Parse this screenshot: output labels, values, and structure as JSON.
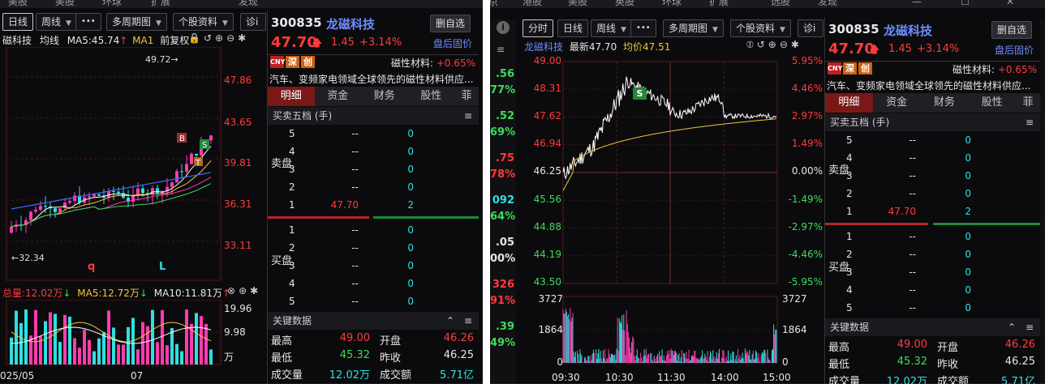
{
  "top_menu_left": [
    "美股",
    "美股",
    "环球",
    "扩展",
    "发现"
  ],
  "top_menu_right": [
    "港股",
    "美股",
    "英股",
    "环球",
    "扩展",
    "选股",
    "发现"
  ],
  "stock": {
    "code": "300835",
    "name": "龙磁科技",
    "price": "47.70",
    "change": "1.45",
    "change_pct": "+3.14%",
    "watch_button": "删自选",
    "after_hours": "盘后固价",
    "tag_cny": "CNY",
    "tag_shen": "深",
    "tag_chuang": "创",
    "sector_label": "磁性材料:",
    "sector_pct": "+0.65%",
    "description": "汽车、变频家电领域全球领先的磁性材料供应..."
  },
  "left_toolbar": {
    "period": "日线",
    "week": "周线",
    "more": "•••",
    "multi": "多周期图",
    "profile": "个股资料",
    "diag": "诊ⅰ"
  },
  "right_toolbar": {
    "period": "分时",
    "day": "日线",
    "week": "周线",
    "more": "•••",
    "multi": "多周期图",
    "profile": "个股资料",
    "diag": "诊ⅰ"
  },
  "kline": {
    "name": "磁科技",
    "ma_label": "均线",
    "ma5": "MA5:45.74",
    "ma1": "MA1",
    "adjust": "前复权",
    "price_axis": [
      "47.86",
      "43.65",
      "39.81",
      "36.31",
      "33.11"
    ],
    "high_note": "49.72",
    "low_note": "32.34",
    "marker_q": "q",
    "marker_l": "L",
    "marker_b": "B",
    "marker_s": "S",
    "marker_t": "T",
    "vol_total": "总量:12.02万",
    "vol_ma5": "MA5:12.72万",
    "vol_ma10": "MA10:11.81万",
    "vol_axis": [
      "19.96",
      "9.98",
      "万"
    ],
    "date_axis": [
      "025/05",
      "07"
    ]
  },
  "intraday": {
    "name": "龙磁科技",
    "latest_label": "最新47.70",
    "avg_label": "均价47.51",
    "price_axis": [
      "49.00",
      "48.31",
      "47.62",
      "46.94",
      "46.25",
      "45.56",
      "44.88",
      "44.19",
      "43.50"
    ],
    "pct_axis": [
      "5.95%",
      "4.46%",
      "2.97%",
      "1.49%",
      "0.00%",
      "-1.49%",
      "-2.97%",
      "-4.46%",
      "-5.95%"
    ],
    "vol_axis_left": [
      "3727",
      "1864",
      "0"
    ],
    "vol_axis_right": [
      "3727",
      "1864",
      "0"
    ],
    "time_axis": [
      "09:30",
      "10:30",
      "11:30",
      "14:00",
      "15:00"
    ],
    "marker_s": "S"
  },
  "tabs": [
    "明细",
    "资金",
    "财务",
    "股性",
    "菲"
  ],
  "orderbook": {
    "title": "买卖五档 (手)",
    "sell_label": "卖盘",
    "buy_label": "买盘",
    "sell": [
      {
        "n": "5",
        "price": "--",
        "vol": "0"
      },
      {
        "n": "4",
        "price": "--",
        "vol": "0"
      },
      {
        "n": "3",
        "price": "--",
        "vol": "0"
      },
      {
        "n": "2",
        "price": "--",
        "vol": "0"
      },
      {
        "n": "1",
        "price": "47.70",
        "vol": "2"
      }
    ],
    "buy": [
      {
        "n": "1",
        "price": "--",
        "vol": "0"
      },
      {
        "n": "2",
        "price": "--",
        "vol": "0"
      },
      {
        "n": "3",
        "price": "--",
        "vol": "0"
      },
      {
        "n": "4",
        "price": "--",
        "vol": "0"
      },
      {
        "n": "5",
        "price": "--",
        "vol": "0"
      }
    ]
  },
  "key_data": {
    "title": "关键数据",
    "rows": [
      {
        "l1": "最高",
        "v1": "49.00",
        "l2": "开盘",
        "v2": "46.26"
      },
      {
        "l1": "最低",
        "v1": "45.32",
        "l2": "昨收",
        "v2": "46.25"
      },
      {
        "l1": "成交量",
        "v1": "12.02万",
        "l2": "成交额",
        "v2": "5.71亿"
      }
    ]
  },
  "side_strip": {
    "left_values": [
      ".56",
      "77%",
      ".52",
      "69%",
      ".75",
      "78%",
      "092",
      "64%",
      ".05",
      "00%",
      "326",
      "91%",
      ".39",
      "49%"
    ]
  },
  "colors": {
    "up": "#ff3b3b",
    "down": "#3ddc5a",
    "cyan": "#2ee0e0",
    "accent": "#6f8cff",
    "tab_sel": "#7a1818"
  }
}
